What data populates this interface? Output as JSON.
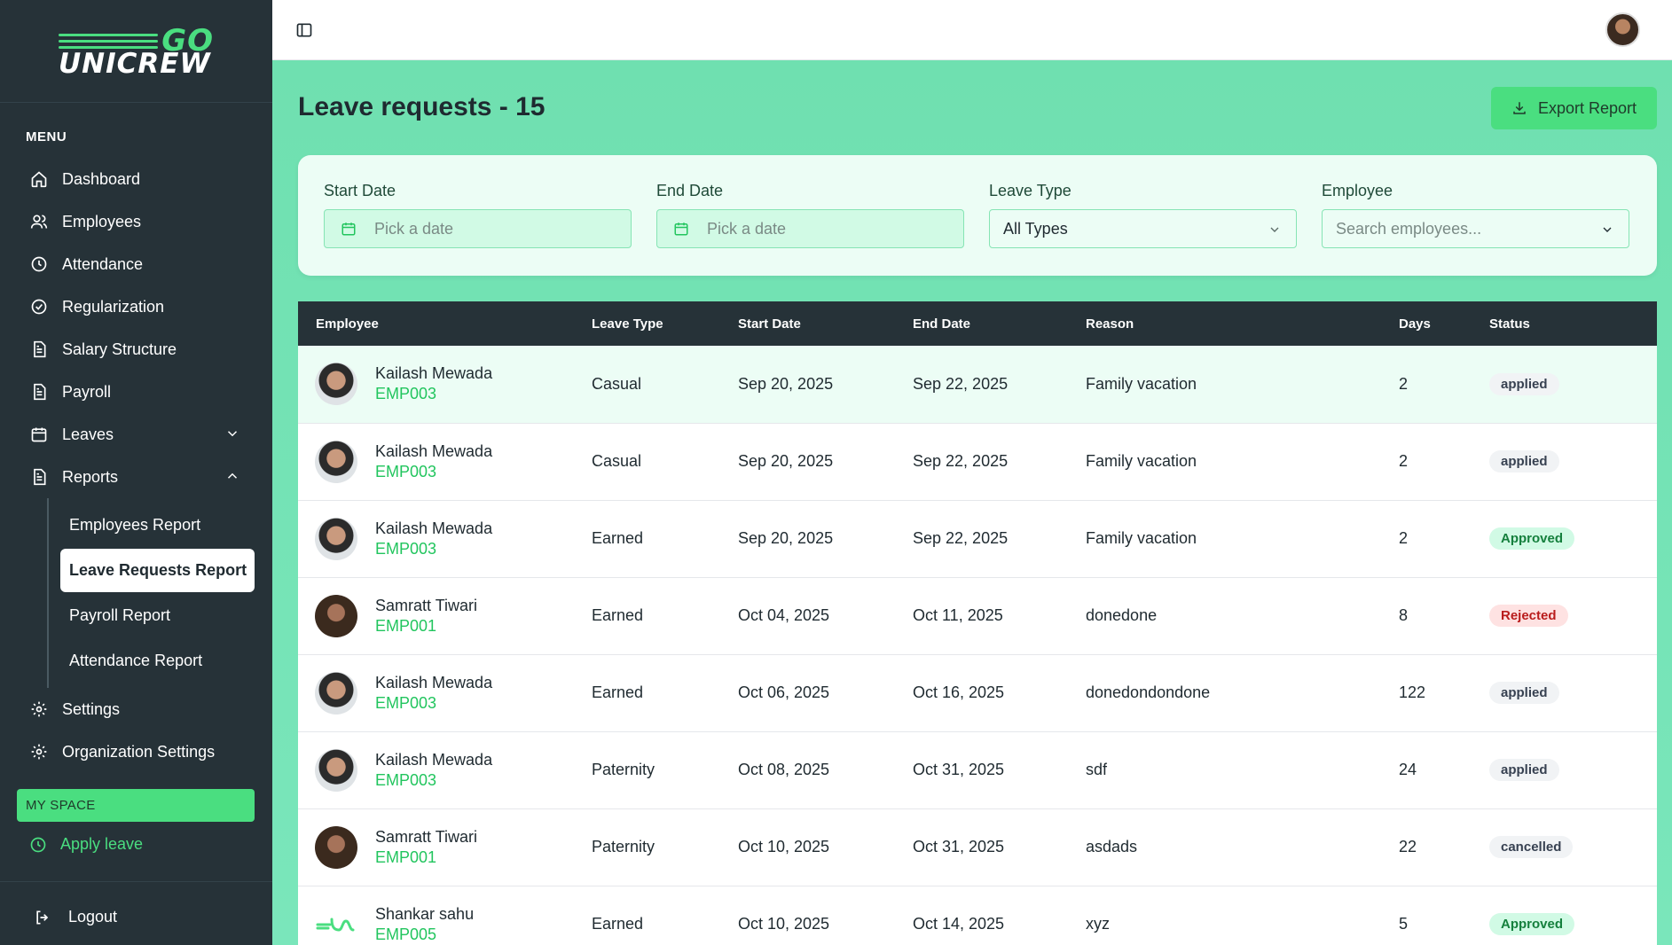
{
  "logo": {
    "top": "GO",
    "bottom": "UNICREW"
  },
  "sidebar": {
    "menu_label": "MENU",
    "items": [
      {
        "label": "Dashboard",
        "icon": "home-icon"
      },
      {
        "label": "Employees",
        "icon": "users-icon"
      },
      {
        "label": "Attendance",
        "icon": "clock-icon"
      },
      {
        "label": "Regularization",
        "icon": "check-circle-icon"
      },
      {
        "label": "Salary Structure",
        "icon": "document-icon"
      },
      {
        "label": "Payroll",
        "icon": "document-icon"
      },
      {
        "label": "Leaves",
        "icon": "calendar-icon"
      },
      {
        "label": "Reports",
        "icon": "document-icon"
      }
    ],
    "reports_sub": [
      {
        "label": "Employees Report"
      },
      {
        "label": "Leave Requests Report"
      },
      {
        "label": "Payroll Report"
      },
      {
        "label": "Attendance Report"
      }
    ],
    "bottom_items": [
      {
        "label": "Settings",
        "icon": "gear-icon"
      },
      {
        "label": "Organization Settings",
        "icon": "gear-icon"
      }
    ],
    "my_space": "MY SPACE",
    "apply_leave": "Apply leave",
    "logout": "Logout"
  },
  "main": {
    "title": "Leave requests - 15",
    "export_label": "Export Report"
  },
  "filters": {
    "start_date": {
      "label": "Start Date",
      "placeholder": "Pick a date"
    },
    "end_date": {
      "label": "End Date",
      "placeholder": "Pick a date"
    },
    "leave_type": {
      "label": "Leave Type",
      "value": "All Types"
    },
    "employee": {
      "label": "Employee",
      "placeholder": "Search employees..."
    }
  },
  "table": {
    "headers": [
      "Employee",
      "Leave Type",
      "Start Date",
      "End Date",
      "Reason",
      "Days",
      "Status"
    ],
    "rows": [
      {
        "name": "Kailash Mewada",
        "id": "EMP003",
        "type": "Casual",
        "start": "Sep 20, 2025",
        "end": "Sep 22, 2025",
        "reason": "Family vacation",
        "days": "2",
        "status": "applied"
      },
      {
        "name": "Kailash Mewada",
        "id": "EMP003",
        "type": "Casual",
        "start": "Sep 20, 2025",
        "end": "Sep 22, 2025",
        "reason": "Family vacation",
        "days": "2",
        "status": "applied"
      },
      {
        "name": "Kailash Mewada",
        "id": "EMP003",
        "type": "Earned",
        "start": "Sep 20, 2025",
        "end": "Sep 22, 2025",
        "reason": "Family vacation",
        "days": "2",
        "status": "Approved"
      },
      {
        "name": "Samratt Tiwari",
        "id": "EMP001",
        "type": "Earned",
        "start": "Oct 04, 2025",
        "end": "Oct 11, 2025",
        "reason": "donedone",
        "days": "8",
        "status": "Rejected"
      },
      {
        "name": "Kailash Mewada",
        "id": "EMP003",
        "type": "Earned",
        "start": "Oct 06, 2025",
        "end": "Oct 16, 2025",
        "reason": "donedondondone",
        "days": "122",
        "status": "applied"
      },
      {
        "name": "Kailash Mewada",
        "id": "EMP003",
        "type": "Paternity",
        "start": "Oct 08, 2025",
        "end": "Oct 31, 2025",
        "reason": "sdf",
        "days": "24",
        "status": "applied"
      },
      {
        "name": "Samratt Tiwari",
        "id": "EMP001",
        "type": "Paternity",
        "start": "Oct 10, 2025",
        "end": "Oct 31, 2025",
        "reason": "asdads",
        "days": "22",
        "status": "cancelled"
      },
      {
        "name": "Shankar sahu",
        "id": "EMP005",
        "type": "Earned",
        "start": "Oct 10, 2025",
        "end": "Oct 14, 2025",
        "reason": "xyz",
        "days": "5",
        "status": "Approved"
      }
    ]
  },
  "colors": {
    "accent": "#4ade80",
    "sidebar_bg": "#263238",
    "main_bg": "#6fe0b0"
  }
}
